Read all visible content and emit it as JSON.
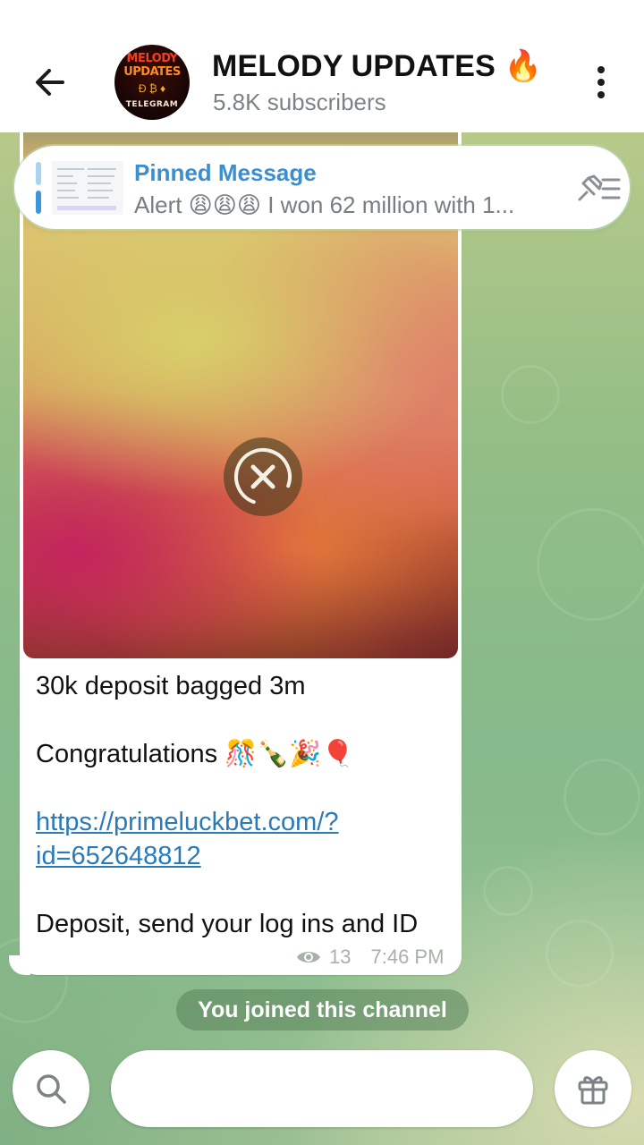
{
  "header": {
    "channel_title": "MELODY UPDATES 🔥",
    "subscribers": "5.8K subscribers",
    "avatar": {
      "line1": "MELODY",
      "line2": "UPDATES",
      "coins": "Ð ₿ ♦",
      "line3": "TELEGRAM"
    }
  },
  "pinned": {
    "title": "Pinned Message",
    "preview": "Alert 😩😩😩  I won 62 million with 1..."
  },
  "message": {
    "line1": "30k deposit bagged 3m",
    "line2": "Congratulations 🎊🍾🎉🎈",
    "link": "https://primeluckbet.com/?id=652648812",
    "line3": "Deposit, send your log ins and ID",
    "views": "13",
    "time": "7:46 PM"
  },
  "service_message": "You joined this channel",
  "icons": {
    "back": "arrow-left-icon",
    "more": "more-vertical-icon",
    "cancel": "close-icon",
    "pin_list": "pin-list-icon",
    "views": "eye-icon",
    "search": "search-icon",
    "gift": "gift-icon"
  },
  "colors": {
    "accent": "#3b8fd1",
    "link": "#2a7ab8",
    "title": "#111111",
    "subtitle": "#7c8387"
  }
}
